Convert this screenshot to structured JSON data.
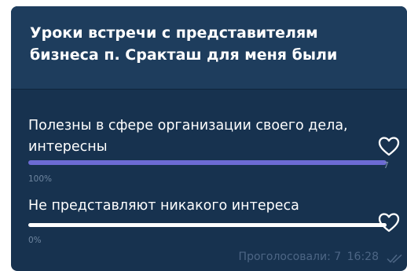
{
  "poll": {
    "question": "Уроки встречи с представителям бизнеса п. Сракташ для меня были",
    "options": [
      {
        "label": "Полезны в сфере организации своего дела, интересны",
        "percent_label": "100%",
        "percent": 100,
        "votes": "7",
        "bar_color": "#6c6bd4"
      },
      {
        "label": "Не представляют никакого интереса",
        "percent_label": "0%",
        "percent": 0,
        "bar_color": "#ffffff"
      }
    ],
    "voted_label": "Проголосовали: 7",
    "time": "16:28"
  },
  "icons": {
    "like": "heart-outline-icon",
    "read_status": "double-check-icon"
  },
  "colors": {
    "card_background": "#17324f",
    "title_background": "#1e3d5d",
    "text": "#ffffff",
    "muted_text": "#6f86a0"
  }
}
